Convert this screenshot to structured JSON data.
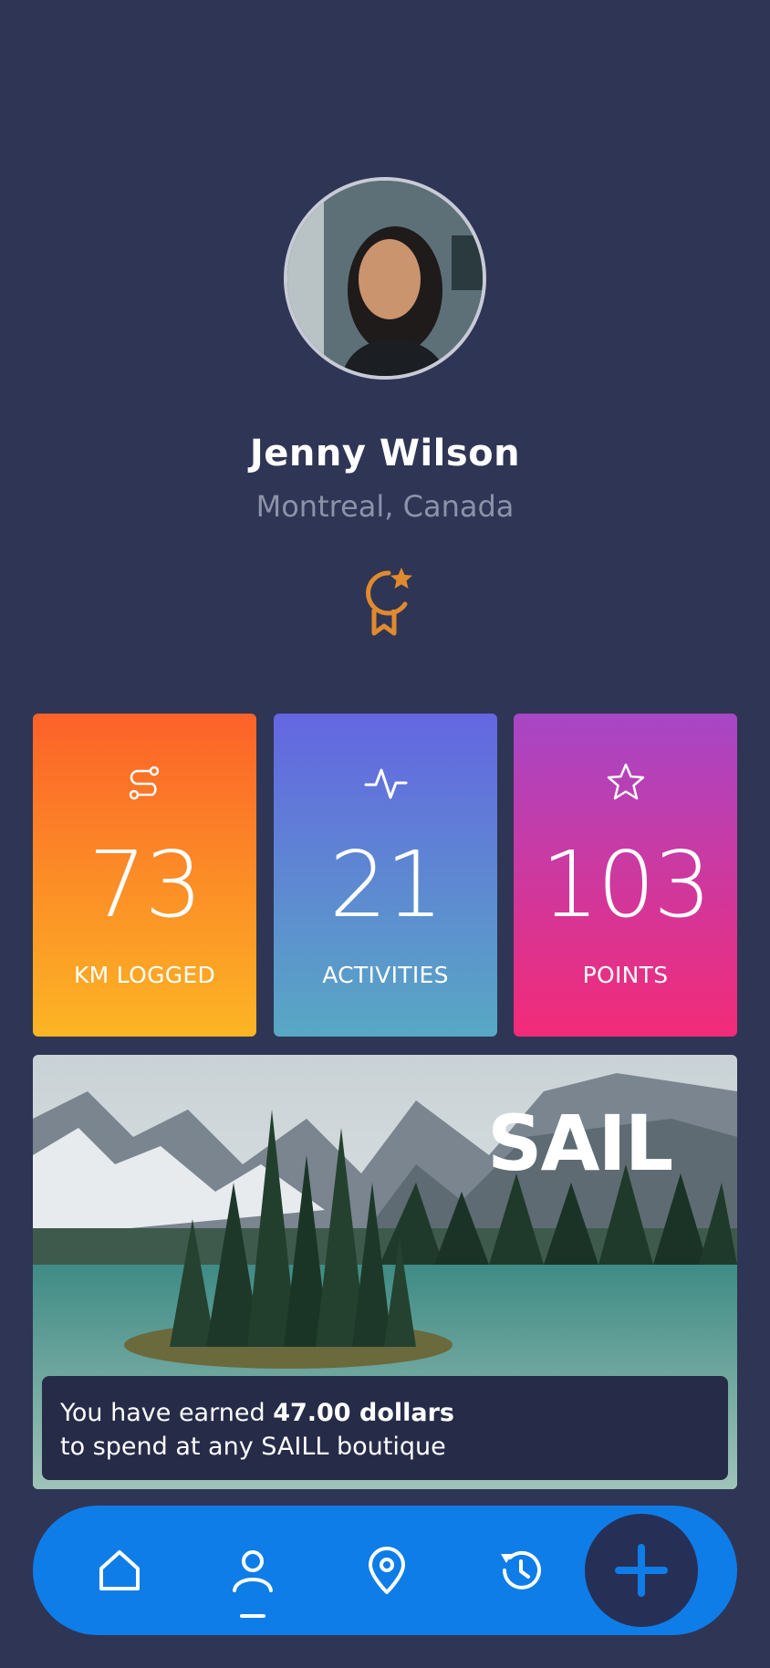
{
  "profile": {
    "name": "Jenny Wilson",
    "location": "Montreal, Canada"
  },
  "stats": [
    {
      "icon": "route-icon",
      "value": "73",
      "label": "KM LOGGED"
    },
    {
      "icon": "activity-pulse-icon",
      "value": "21",
      "label": "ACTIVITIES"
    },
    {
      "icon": "star-icon",
      "value": "103",
      "label": "POINTS"
    }
  ],
  "promo": {
    "brand": "SAIL",
    "line1_prefix": "You have earned ",
    "amount": "47.00 dollars",
    "line2": "to spend at any SAILL boutique"
  },
  "nav": {
    "items": [
      "home-icon",
      "profile-icon",
      "map-pin-icon",
      "history-icon"
    ],
    "active": "profile-icon",
    "fab": "plus-icon"
  },
  "colors": {
    "background": "#2f3555",
    "accent": "#0e7de8",
    "badge": "#e08a2e"
  }
}
